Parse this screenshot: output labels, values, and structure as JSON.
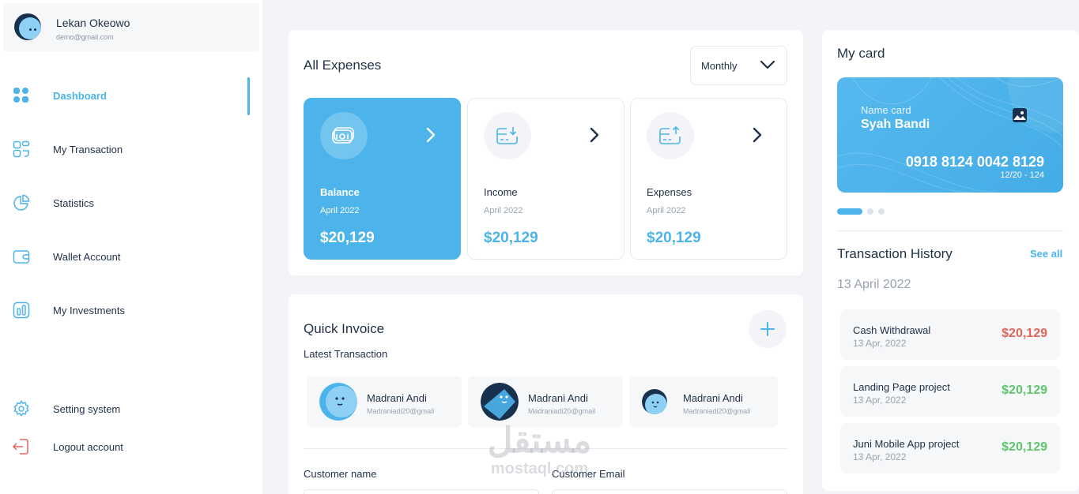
{
  "profile": {
    "name": "Lekan Okeowo",
    "email": "demo@gmail.com"
  },
  "nav": [
    {
      "label": "Dashboard",
      "icon": "dashboard-grid-icon",
      "active": true
    },
    {
      "label": "My Transaction",
      "icon": "transaction-icon"
    },
    {
      "label": "Statistics",
      "icon": "pie-chart-icon"
    },
    {
      "label": "Wallet Account",
      "icon": "wallet-icon"
    },
    {
      "label": "My Investments",
      "icon": "bar-chart-icon"
    }
  ],
  "nav_bottom": [
    {
      "label": "Setting system",
      "icon": "gear-icon"
    },
    {
      "label": "Logout account",
      "icon": "logout-icon"
    }
  ],
  "expenses": {
    "title": "All Expenses",
    "period": "Monthly",
    "cards": [
      {
        "label": "Balance",
        "date": "April 2022",
        "value": "$20,129",
        "icon": "wallet-cash-icon"
      },
      {
        "label": "Income",
        "date": "April 2022",
        "value": "$20,129",
        "icon": "card-download-icon"
      },
      {
        "label": "Expenses",
        "date": "April 2022",
        "value": "$20,129",
        "icon": "card-upload-icon"
      }
    ]
  },
  "invoice": {
    "title": "Quick Invoice",
    "subtitle": "Latest Transaction",
    "contacts": [
      {
        "name": "Madrani Andi",
        "email": "Madraniadi20@gmail"
      },
      {
        "name": "Madrani Andi",
        "email": "Madraniadi20@gmail"
      },
      {
        "name": "Madrani Andi",
        "email": "Madraniadi20@gmail"
      }
    ],
    "field_customer_name": "Customer name",
    "field_customer_email": "Customer Email"
  },
  "card": {
    "title": "My card",
    "label": "Name card",
    "holder": "Syah Bandi",
    "number": "0918 8124 0042 8129",
    "expiry": "12/20 - 124"
  },
  "history": {
    "title": "Transaction History",
    "see_all": "See all",
    "date": "13 April 2022",
    "items": [
      {
        "title": "Cash Withdrawal",
        "date": "13 Apr, 2022",
        "amount": "$20,129",
        "color": "#e2655b"
      },
      {
        "title": "Landing Page project",
        "date": "13 Apr, 2022",
        "amount": "$20,129",
        "color": "#5fc66b"
      },
      {
        "title": "Juni Mobile App project",
        "date": "13 Apr, 2022",
        "amount": "$20,129",
        "color": "#5fc66b"
      }
    ]
  },
  "watermark": {
    "arabic": "مستقل",
    "latin": "mostaql.com"
  },
  "colors": {
    "accent": "#4cb4ea",
    "text": "#1f3047",
    "muted": "#9aa3b0"
  }
}
